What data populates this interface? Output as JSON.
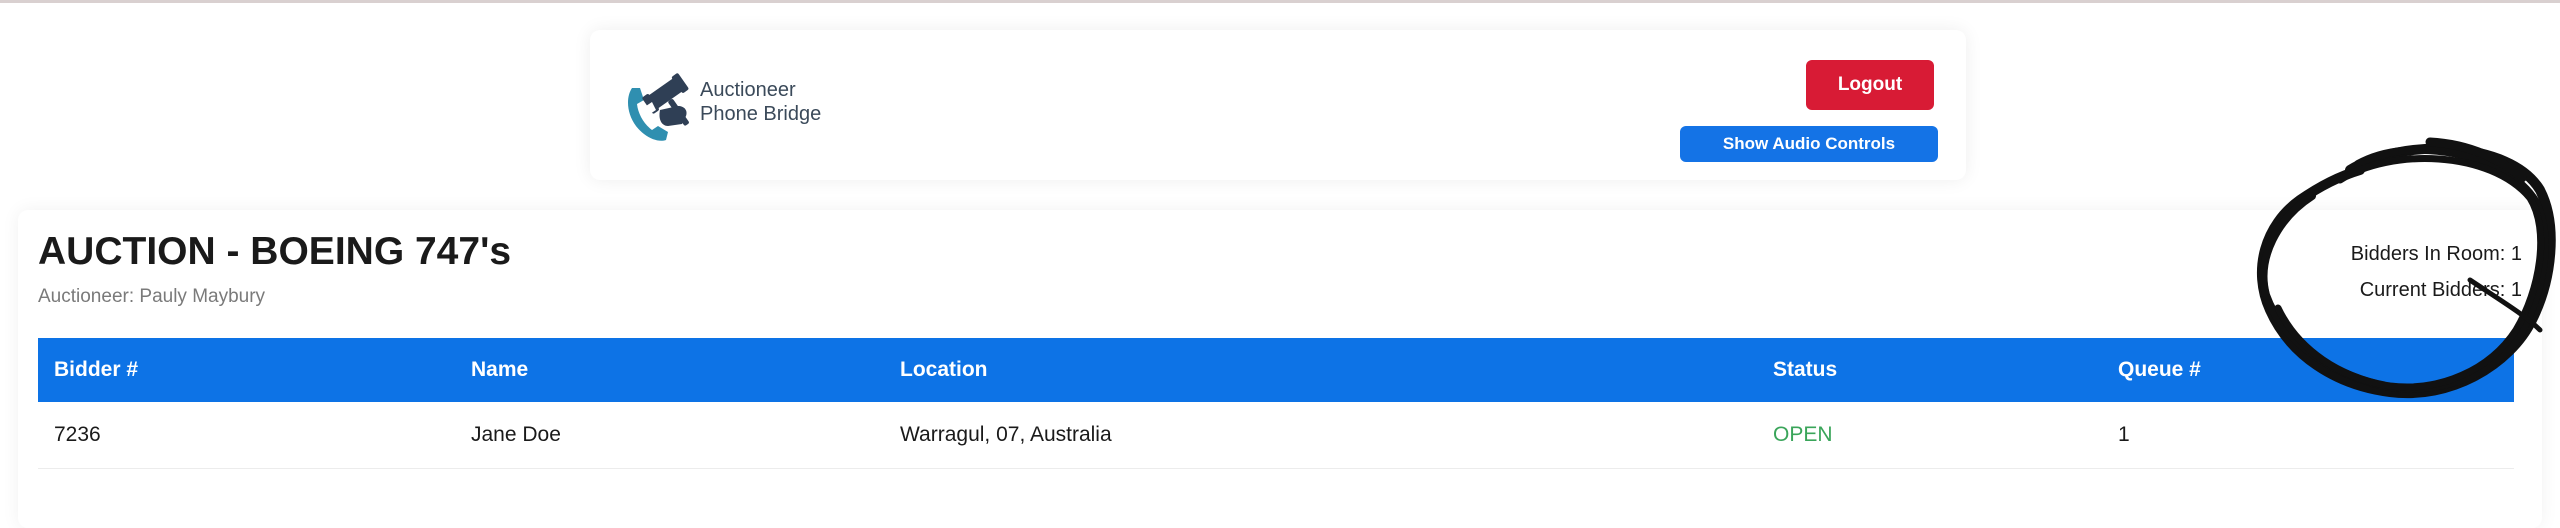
{
  "header": {
    "logo": {
      "line1": "Auctioneer",
      "line2": "Phone Bridge",
      "icon": "phone-gavel-icon"
    },
    "logout_label": "Logout",
    "audio_label": "Show Audio Controls"
  },
  "auction": {
    "title": "AUCTION - BOEING 747's",
    "auctioneer": "Auctioneer: Pauly Maybury",
    "stats": {
      "bidders_in_room": "Bidders In Room: 1",
      "current_bidders": "Current Bidders: 1"
    }
  },
  "table": {
    "columns": [
      "Bidder #",
      "Name",
      "Location",
      "Status",
      "Queue #"
    ],
    "rows": [
      {
        "bidder": "7236",
        "name": "Jane Doe",
        "location": "Warragul, 07, Australia",
        "status": "OPEN",
        "queue": "1"
      }
    ]
  },
  "colors": {
    "primary_blue": "#0d73e6",
    "logout_red": "#d81b35",
    "status_open_green": "#3aa55a"
  }
}
